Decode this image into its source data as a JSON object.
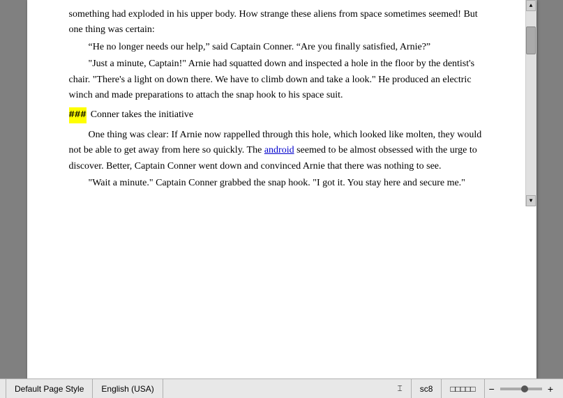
{
  "document": {
    "paragraphs": [
      {
        "type": "text",
        "content": "something had exploded in his upper body. How strange these aliens from space sometimes seemed! But one thing was certain:"
      },
      {
        "type": "indent-text",
        "content": "“He no longer needs our help,” said Captain Conner. “Are you finally satisfied, Arnie?”"
      },
      {
        "type": "indent-text",
        "content": "“Just a minute, Captain!” Arnie had squatted down and inspected a hole in the floor by the dentist’s chair. “There’s a light on down there. We have to climb down and take a look.” He produced an electric winch and made preparations to attach the snap hook to his space suit."
      },
      {
        "type": "heading",
        "marker": "###",
        "text": "Conner takes the initiative"
      },
      {
        "type": "indent-text",
        "content": "One thing was clear: If Arnie now rappelled through this hole, which looked like molten, they would not be able to get away from here so quickly. The android seemed to be almost obsessed with the urge to discover. Better, Captain Conner went down and convinced Arnie that there was nothing to see."
      },
      {
        "type": "indent-text",
        "content": "“Wait a minute.” Captain Conner grabbed the snap hook. “I got it. You stay here and secure me.”"
      }
    ]
  },
  "status_bar": {
    "page_style": "Default Page Style",
    "language": "English (USA)",
    "cursor_icon": "⌶",
    "page_ref": "sc8",
    "zoom_minus": "−",
    "zoom_plus": "+"
  },
  "link_word": "android"
}
